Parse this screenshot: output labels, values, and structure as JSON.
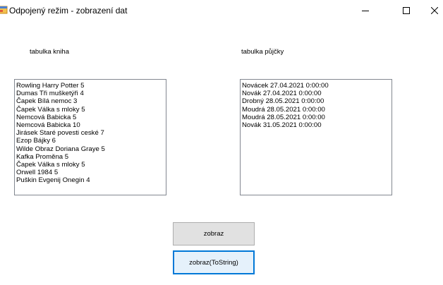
{
  "window": {
    "title": "Odpojený režim - zobrazení dat",
    "minimize_glyph": "—",
    "maximize_glyph": "☐",
    "close_glyph": "✕",
    "app_icon": "app-form-icon"
  },
  "labels": {
    "kniha": "tabulka kniha",
    "pujcky": "tabulka půjčky"
  },
  "kniha_items": [
    "Rowling Harry Potter 5",
    "Dumas Tři mušketýři 4",
    "Čapek Bílá nemoc 3",
    "Čapek Válka s mloky 5",
    "Nemcová Babicka 5",
    "Nemcová Babicka 10",
    "Jirásek Staré povesti ceské 7",
    "Ezop Bájky 6",
    "Wilde Obraz Doriana Graye 5",
    "Kafka Proměna 5",
    "Čapek Válka s mloky 5",
    "Orwell 1984 5",
    "Puškin Evgenij Onegin 4"
  ],
  "pujcky_items": [
    "Novácek 27.04.2021 0:00:00",
    "Novák 27.04.2021 0:00:00",
    "Drobný 28.05.2021 0:00:00",
    "Moudrá 28.05.2021 0:00:00",
    "Moudrá 28.05.2021 0:00:00",
    "Novák 31.05.2021 0:00:00"
  ],
  "buttons": {
    "zobraz": "zobraz",
    "tostring": "zobraz(ToString)"
  },
  "colors": {
    "focus_border": "#0078d7",
    "button_face": "#e1e1e1"
  }
}
